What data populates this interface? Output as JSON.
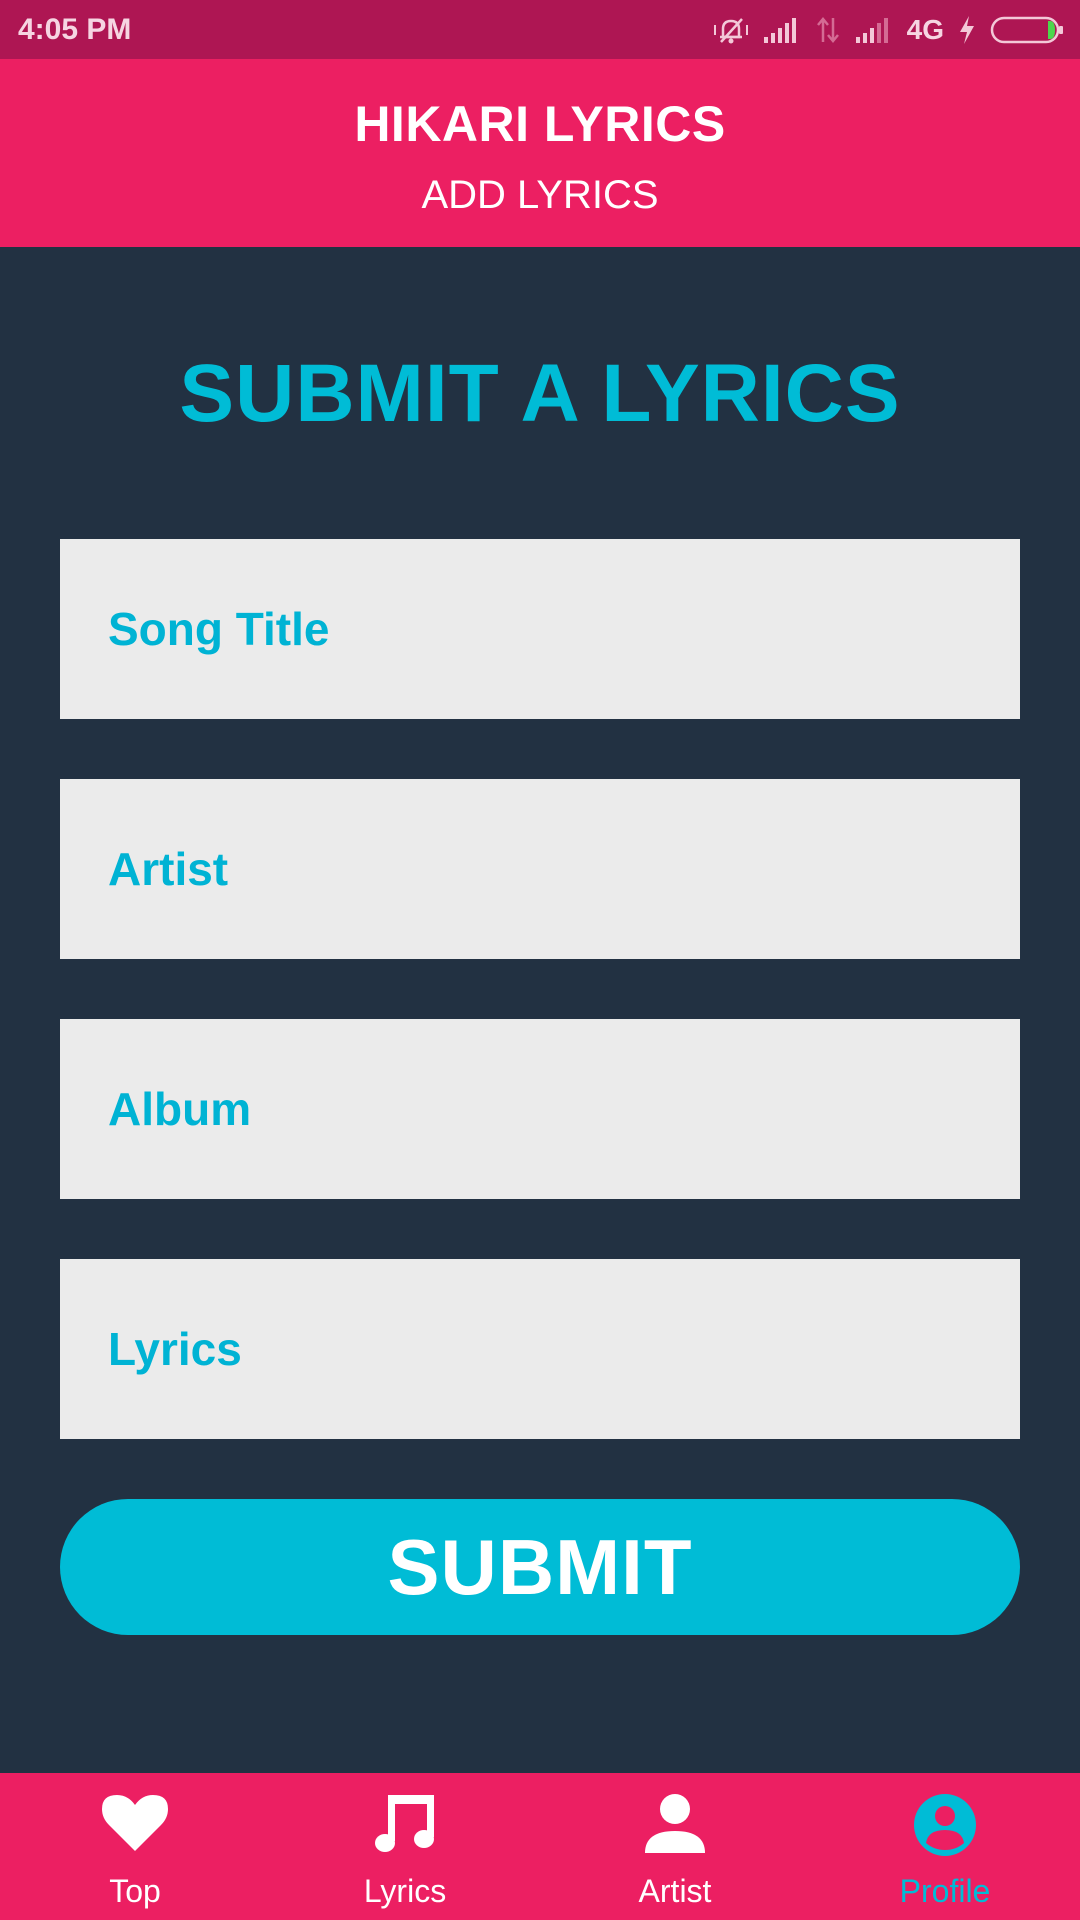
{
  "status_bar": {
    "time": "4:05 PM",
    "network": "4G",
    "icons": [
      "vibrate-off-icon",
      "signal-icon",
      "data-arrows-icon",
      "signal-icon",
      "charging-icon",
      "battery-icon"
    ]
  },
  "header": {
    "title": "HIKARI LYRICS",
    "subtitle": "ADD LYRICS"
  },
  "form": {
    "heading": "SUBMIT A LYRICS",
    "song_title_placeholder": "Song Title",
    "artist_placeholder": "Artist",
    "album_placeholder": "Album",
    "lyrics_placeholder": "Lyrics",
    "submit_label": "SUBMIT"
  },
  "bottom_nav": {
    "items": [
      {
        "label": "Top",
        "icon": "heart-icon"
      },
      {
        "label": "Lyrics",
        "icon": "music-note-icon"
      },
      {
        "label": "Artist",
        "icon": "person-icon"
      },
      {
        "label": "Profile",
        "icon": "account-circle-icon",
        "active": true
      }
    ]
  },
  "colors": {
    "primary": "#ec1f62",
    "status_bar": "#ae1653",
    "background": "#223142",
    "accent": "#00bcd6",
    "field_background": "#ebebeb"
  }
}
